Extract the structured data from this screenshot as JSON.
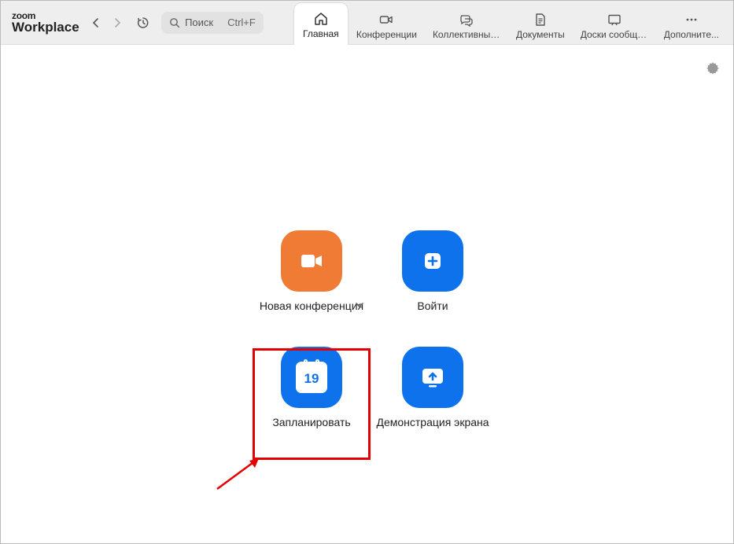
{
  "logo": {
    "top": "zoom",
    "bottom": "Workplace"
  },
  "search": {
    "placeholder": "Поиск",
    "shortcut": "Ctrl+F"
  },
  "tabs": [
    {
      "label": "Главная"
    },
    {
      "label": "Конференции"
    },
    {
      "label": "Коллективный ч..."
    },
    {
      "label": "Документы"
    },
    {
      "label": "Доски сообще..."
    },
    {
      "label": "Дополните..."
    }
  ],
  "tiles": {
    "new_meeting": "Новая конференция",
    "join": "Войти",
    "schedule": "Запланировать",
    "share_screen": "Демонстрация экрана"
  },
  "calendar_day": "19"
}
